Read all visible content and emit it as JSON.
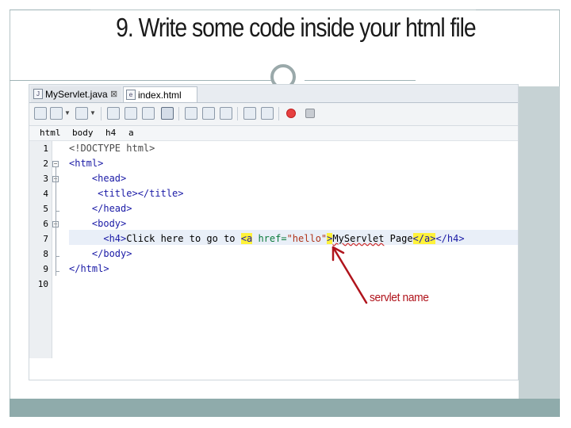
{
  "slide": {
    "title": "9.  Write some code inside your html file"
  },
  "ide": {
    "tabs": [
      {
        "label": "MyServlet.java",
        "close": "⊠",
        "active": false
      },
      {
        "label": "index.html",
        "close": "⊠",
        "active": true
      }
    ],
    "breadcrumb": [
      "html",
      "body",
      "h4",
      "a"
    ],
    "line_numbers": [
      "1",
      "2",
      "3",
      "4",
      "5",
      "6",
      "7",
      "8",
      "9",
      "10"
    ],
    "code": {
      "l1": "<!DOCTYPE html>",
      "l2": "<html>",
      "l3": "<head>",
      "l4_open": "<title>",
      "l4_close": "</title>",
      "l5": "</head>",
      "l6": "<body>",
      "l7_h4": "<h4>",
      "l7_text": "Click here to go to ",
      "l7_a_open": "<a",
      "l7_attr": "href=",
      "l7_value": "\"hello\"",
      "l7_gt": ">",
      "l7_link_word1": "MyServlet",
      "l7_link_word2": " Page",
      "l7_a_close": "</a>",
      "l7_h4_close": "</h4>",
      "l8": "</body>",
      "l9": "</html>"
    }
  },
  "annotation": {
    "label": "servlet name",
    "color": "#b0141c"
  },
  "colors": {
    "frame": "#b5c4c6",
    "side_panel": "#c6d2d4",
    "bottom_bar": "#8fabab",
    "tag": "#1a1aa6",
    "match_highlight": "#fff23a"
  }
}
